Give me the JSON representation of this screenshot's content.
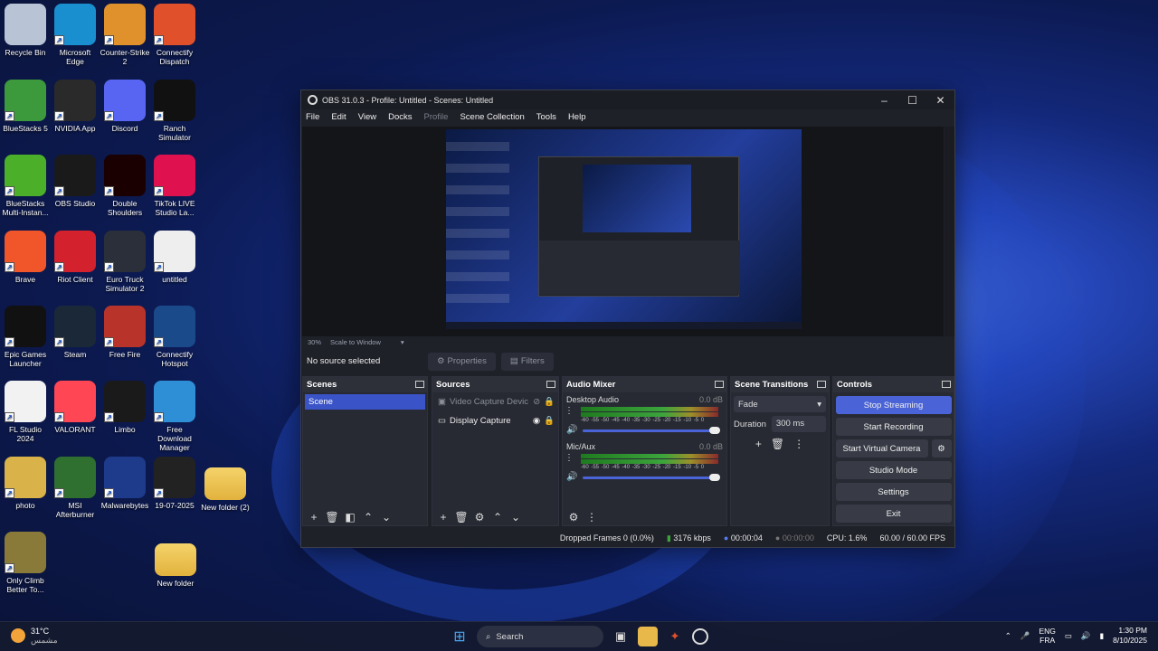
{
  "desktop_icons": [
    {
      "label": "Recycle Bin",
      "icon": "recycle-bin-icon",
      "color": "#b8c4d6"
    },
    {
      "label": "Microsoft Edge",
      "icon": "edge-icon",
      "color": "#1a8fd0"
    },
    {
      "label": "Counter-Strike 2",
      "icon": "counter-strike-icon",
      "color": "#e0912b"
    },
    {
      "label": "Connectify Dispatch",
      "icon": "connectify-dispatch-icon",
      "color": "#e0502b"
    },
    {
      "label": "BlueStacks 5",
      "icon": "bluestacks-icon",
      "color": "#3c9a3c"
    },
    {
      "label": "NVIDIA App",
      "icon": "nvidia-icon",
      "color": "#2a2a2a"
    },
    {
      "label": "Discord",
      "icon": "discord-icon",
      "color": "#5865f2"
    },
    {
      "label": "Ranch Simulator",
      "icon": "ranch-simulator-icon",
      "color": "#111111"
    },
    {
      "label": "BlueStacks Multi-Instan...",
      "icon": "bluestacks-multi-icon",
      "color": "#4caf2a"
    },
    {
      "label": "OBS Studio",
      "icon": "obs-icon",
      "color": "#1a1a1a"
    },
    {
      "label": "Double Shoulders",
      "icon": "double-shoulders-icon",
      "color": "#1a0000"
    },
    {
      "label": "TikTok LIVE Studio La...",
      "icon": "tiktok-icon",
      "color": "#e0114f"
    },
    {
      "label": "Brave",
      "icon": "brave-icon",
      "color": "#f0562a"
    },
    {
      "label": "Riot Client",
      "icon": "riot-icon",
      "color": "#d3212d"
    },
    {
      "label": "Euro Truck Simulator 2",
      "icon": "euro-truck-icon",
      "color": "#2a2f3a"
    },
    {
      "label": "untitled",
      "icon": "media-file-icon",
      "color": "#eeeeee"
    },
    {
      "label": "Epic Games Launcher",
      "icon": "epic-games-icon",
      "color": "#111111"
    },
    {
      "label": "Steam",
      "icon": "steam-icon",
      "color": "#1b2838"
    },
    {
      "label": "Free Fire",
      "icon": "free-fire-icon",
      "color": "#b8342a"
    },
    {
      "label": "Connectify Hotspot",
      "icon": "connectify-hotspot-icon",
      "color": "#1a4a8a"
    },
    {
      "label": "FL Studio 2024",
      "icon": "document-icon",
      "color": "#f2f2f2"
    },
    {
      "label": "VALORANT",
      "icon": "valorant-icon",
      "color": "#ff4655"
    },
    {
      "label": "Limbo",
      "icon": "limbo-icon",
      "color": "#1a1a1a"
    },
    {
      "label": "Free Download Manager",
      "icon": "fdm-icon",
      "color": "#2f8fd6"
    },
    {
      "label": "photo",
      "icon": "folder-icon",
      "color": "#d9b24a"
    },
    {
      "label": "MSI Afterburner",
      "icon": "msi-icon",
      "color": "#2f6f2f"
    },
    {
      "label": "Malwarebytes",
      "icon": "malwarebytes-icon",
      "color": "#1e3a8a"
    },
    {
      "label": "19-07-2025",
      "icon": "video-file-icon",
      "color": "#222222"
    },
    {
      "label": "Only Climb Better To...",
      "icon": "only-climb-icon",
      "color": "#8a7a3a"
    }
  ],
  "desktop_folders": [
    {
      "label": "New folder (2)",
      "icon": "folder-icon"
    },
    {
      "label": "New folder",
      "icon": "folder-icon"
    }
  ],
  "obs": {
    "title": "OBS 31.0.3 - Profile: Untitled - Scenes: Untitled",
    "menu": [
      "File",
      "Edit",
      "View",
      "Docks",
      "Profile",
      "Scene Collection",
      "Tools",
      "Help"
    ],
    "zoom_label": "30%",
    "scale_label": "Scale to Window",
    "no_source": "No source selected",
    "properties_label": "Properties",
    "filters_label": "Filters",
    "docks": {
      "scenes_title": "Scenes",
      "scenes": [
        "Scene"
      ],
      "sources_title": "Sources",
      "sources": [
        {
          "name": "Video Capture Devic",
          "visible": false
        },
        {
          "name": "Display Capture",
          "visible": true
        }
      ],
      "mixer_title": "Audio Mixer",
      "channels": [
        {
          "name": "Desktop Audio",
          "db": "0.0 dB",
          "level": 0.62
        },
        {
          "name": "Mic/Aux",
          "db": "0.0 dB",
          "level": 0.56
        }
      ],
      "meter_ticks": "-60 -55 -50 -45 -40 -35 -30 -25 -20 -15 -10 -5 0",
      "transitions_title": "Scene Transitions",
      "transition": "Fade",
      "duration_label": "Duration",
      "duration_value": "300 ms",
      "controls_title": "Controls",
      "controls": {
        "stop_streaming": "Stop Streaming",
        "start_recording": "Start Recording",
        "start_virtual_camera": "Start Virtual Camera",
        "studio_mode": "Studio Mode",
        "settings": "Settings",
        "exit": "Exit"
      }
    },
    "status": {
      "dropped_frames": "Dropped Frames 0 (0.0%)",
      "bitrate": "3176 kbps",
      "stream_time": "00:00:04",
      "record_time": "00:00:00",
      "cpu": "CPU: 1.6%",
      "fps": "60.00 / 60.00 FPS"
    }
  },
  "taskbar": {
    "weather_temp": "31°C",
    "weather_desc": "مشمس",
    "search_label": "Search",
    "language": "ENG",
    "layout": "FRA",
    "time": "1:30 PM",
    "date": "8/10/2025"
  },
  "colors": {
    "accent": "#4a64d8",
    "obs_bg": "#1f2129",
    "dock_bg": "#272a33"
  }
}
